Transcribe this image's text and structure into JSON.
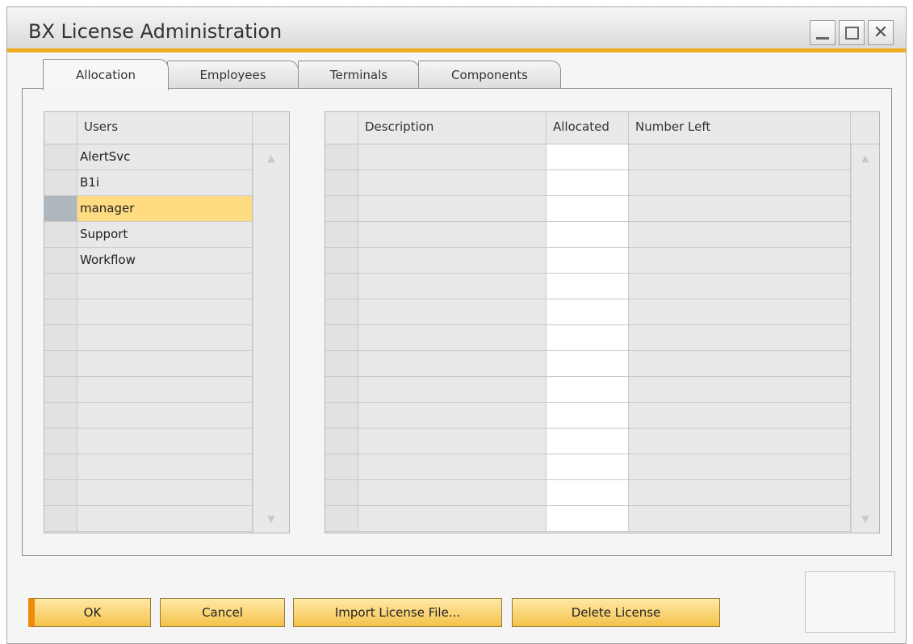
{
  "window": {
    "title": "BX License Administration"
  },
  "tabs": [
    {
      "label": "Allocation",
      "active": true
    },
    {
      "label": "Employees",
      "active": false
    },
    {
      "label": "Terminals",
      "active": false
    },
    {
      "label": "Components",
      "active": false
    }
  ],
  "users_table": {
    "header": "Users",
    "rows": [
      "AlertSvc",
      "B1i",
      "manager",
      "Support",
      "Workflow"
    ],
    "selected": "manager"
  },
  "license_table": {
    "headers": {
      "description": "Description",
      "allocated": "Allocated",
      "number_left": "Number Left"
    }
  },
  "buttons": {
    "ok": "OK",
    "cancel": "Cancel",
    "import": "Import License File...",
    "delete": "Delete License"
  },
  "colors": {
    "accent": "#f0ab1e",
    "selected_row": "#ffdb81",
    "button_gradient_top": "#ffe9a8",
    "button_gradient_bottom": "#f5c24a"
  },
  "icons": {
    "minimize": "minimize-icon",
    "maximize": "maximize-icon",
    "close": "close-icon",
    "scroll_up": "scroll-up-icon",
    "scroll_down": "scroll-down-icon"
  }
}
